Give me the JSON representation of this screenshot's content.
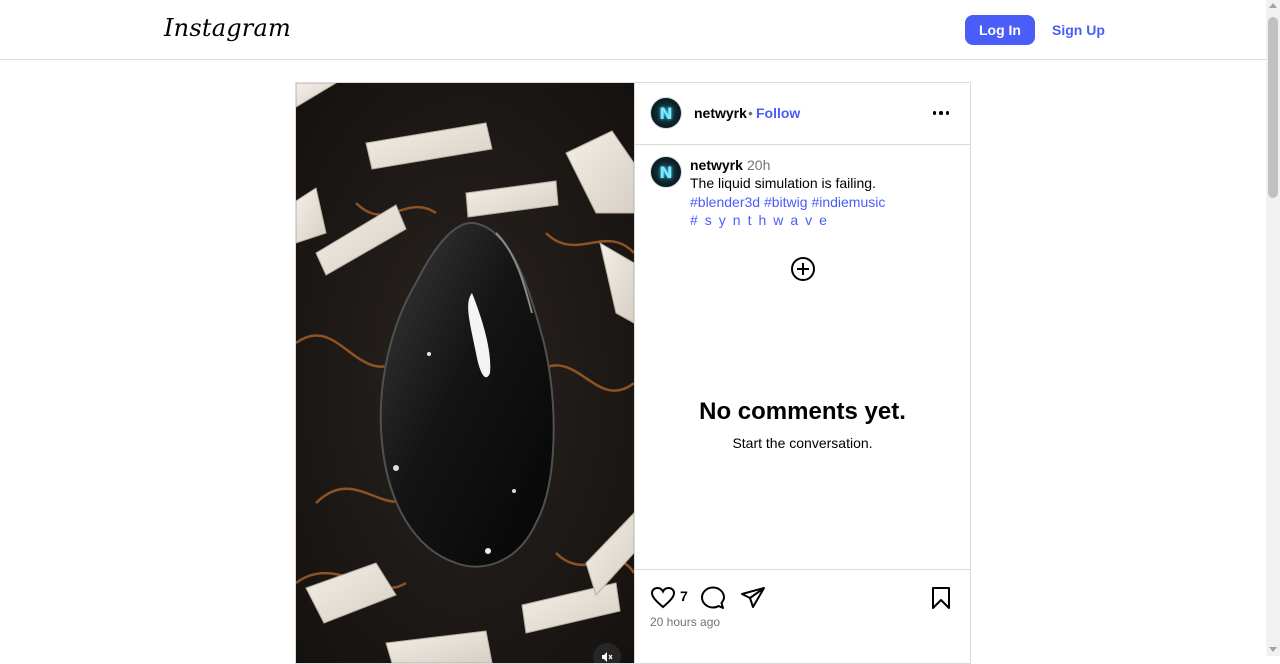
{
  "nav": {
    "logo": "Instagram",
    "login_label": "Log In",
    "signup_label": "Sign Up"
  },
  "post": {
    "author": "netwyrk",
    "follow_label": "Follow",
    "separator": "•",
    "caption": {
      "author": "netwyrk",
      "time": "20h",
      "text": "The liquid simulation is failing.",
      "hashtags": [
        "#blender3d",
        "#bitwig",
        "#indiemusic",
        "#synthwave"
      ]
    },
    "comments": {
      "empty_title": "No comments yet.",
      "empty_subtitle": "Start the conversation."
    },
    "likes": "7",
    "posted_ago": "20 hours ago",
    "avatar_initial": "N"
  },
  "colors": {
    "accent": "#4a5df9",
    "muted_text": "#737373",
    "border": "#dbdbdb"
  },
  "icons": [
    "more-options-icon",
    "add-comment-icon",
    "heart-icon",
    "comment-icon",
    "share-icon",
    "bookmark-icon",
    "muted-audio-icon"
  ]
}
